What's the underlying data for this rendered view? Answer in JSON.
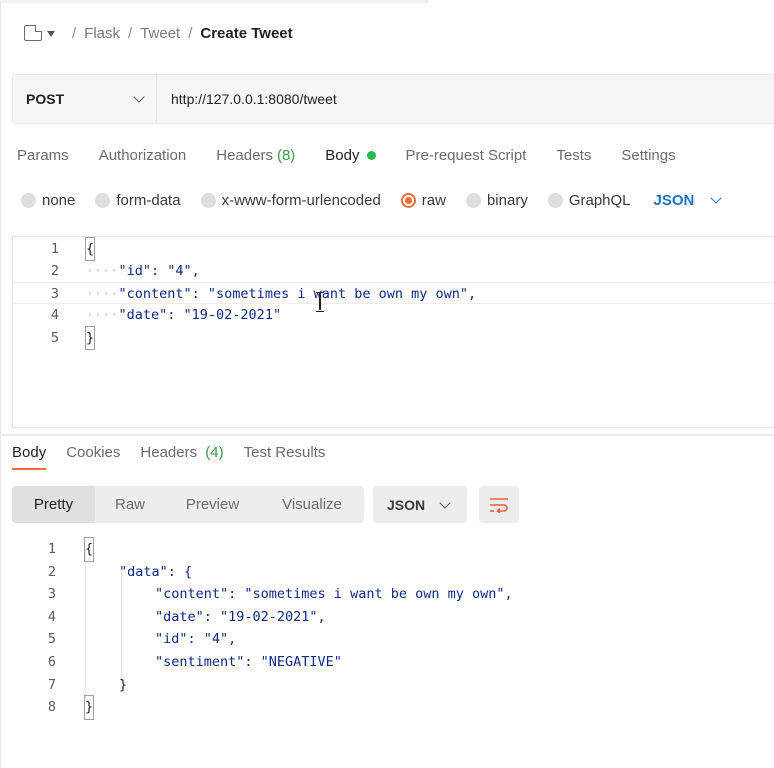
{
  "breadcrumb": {
    "items": [
      "Flask",
      "Tweet"
    ],
    "separator": "/",
    "current": "Create Tweet"
  },
  "request": {
    "method": "POST",
    "url": "http://127.0.0.1:8080/tweet"
  },
  "request_tabs": [
    {
      "label": "Params"
    },
    {
      "label": "Authorization"
    },
    {
      "label": "Headers",
      "count": "(8)"
    },
    {
      "label": "Body",
      "active": true
    },
    {
      "label": "Pre-request Script"
    },
    {
      "label": "Tests"
    },
    {
      "label": "Settings"
    }
  ],
  "body_types": [
    "none",
    "form-data",
    "x-www-form-urlencoded",
    "raw",
    "binary",
    "GraphQL"
  ],
  "body_type_selected": "raw",
  "body_format": "JSON",
  "request_body": {
    "line_numbers": [
      "1",
      "2",
      "3",
      "4",
      "5"
    ],
    "lines": [
      "{",
      "\"id\": \"4\",",
      "\"content\": \"sometimes i want be own my own\",",
      "\"date\": \"19-02-2021\"",
      "}"
    ]
  },
  "response_tabs": [
    {
      "label": "Body",
      "active": true
    },
    {
      "label": "Cookies"
    },
    {
      "label": "Headers",
      "count": "(4)"
    },
    {
      "label": "Test Results"
    }
  ],
  "response_view_modes": [
    "Pretty",
    "Raw",
    "Preview",
    "Visualize"
  ],
  "response_view_selected": "Pretty",
  "response_format": "JSON",
  "response_body": {
    "line_numbers": [
      "1",
      "2",
      "3",
      "4",
      "5",
      "6",
      "7",
      "8"
    ],
    "lines": [
      "{",
      "\"data\": {",
      "\"content\": \"sometimes i want be own my own\",",
      "\"date\": \"19-02-2021\",",
      "\"id\": \"4\",",
      "\"sentiment\": \"NEGATIVE\"",
      "}",
      "}"
    ]
  },
  "colors": {
    "accent": "#f26b3a",
    "link_blue": "#1a73c8",
    "status_green": "#2db84c",
    "json_key": "#0e2a88",
    "json_string": "#1f5ea8"
  },
  "icons": [
    "collection-icon",
    "dropdown-caret-icon",
    "chevron-down-icon",
    "wrap-lines-icon",
    "text-cursor-icon"
  ]
}
